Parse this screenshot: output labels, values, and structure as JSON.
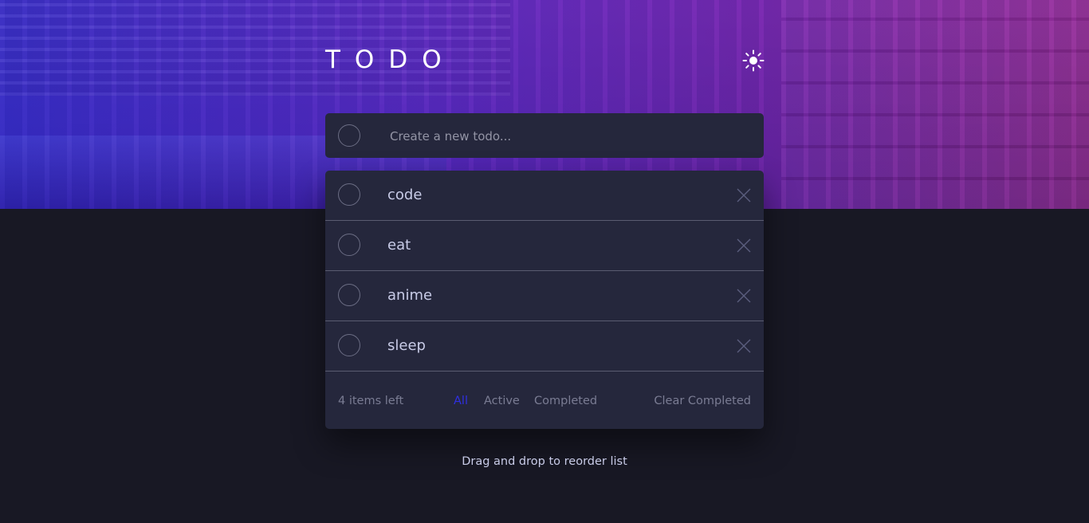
{
  "header": {
    "title": "TODO",
    "theme_icon": "sun-icon"
  },
  "new_todo": {
    "placeholder": "Create a new todo..."
  },
  "todos": [
    {
      "label": "code"
    },
    {
      "label": "eat"
    },
    {
      "label": "anime"
    },
    {
      "label": "sleep"
    }
  ],
  "footer": {
    "items_left": "4 items left",
    "filters": {
      "all": "All",
      "active": "Active",
      "completed": "Completed"
    },
    "clear": "Clear Completed"
  },
  "hint": "Drag and drop to reorder list",
  "colors": {
    "background": "#181824",
    "card": "#25273c",
    "text": "#c8cbe7",
    "muted": "#7a7c93",
    "active_filter": "#2f2fe0",
    "gradient_start": "#3a2fc4",
    "gradient_end": "#8a2a8f"
  }
}
